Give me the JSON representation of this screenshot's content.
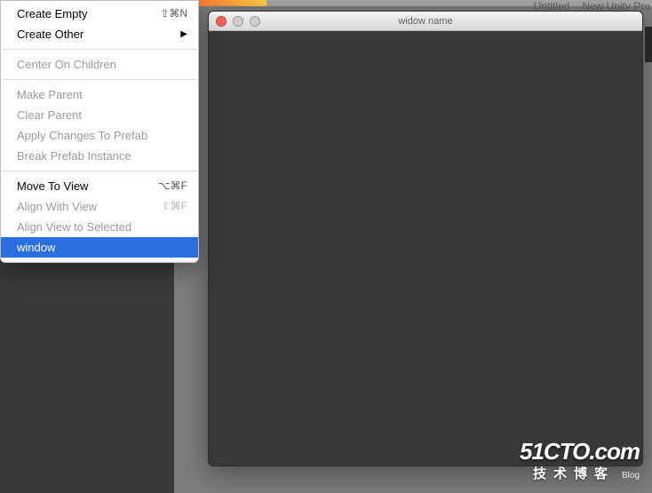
{
  "top_titles": {
    "a": "Untitled",
    "b": "New Unity Pro"
  },
  "menu": {
    "items": [
      {
        "label": "Create Empty",
        "shortcut": "⇧⌘N",
        "enabled": true,
        "submenu": false
      },
      {
        "label": "Create Other",
        "shortcut": "",
        "enabled": true,
        "submenu": true
      }
    ],
    "sep1": true,
    "group2": [
      {
        "label": "Center On Children",
        "shortcut": "",
        "enabled": false
      }
    ],
    "sep2": true,
    "group3": [
      {
        "label": "Make Parent",
        "shortcut": "",
        "enabled": false
      },
      {
        "label": "Clear Parent",
        "shortcut": "",
        "enabled": false
      },
      {
        "label": "Apply Changes To Prefab",
        "shortcut": "",
        "enabled": false
      },
      {
        "label": "Break Prefab Instance",
        "shortcut": "",
        "enabled": false
      }
    ],
    "sep3": true,
    "group4": [
      {
        "label": "Move To View",
        "shortcut": "⌥⌘F",
        "enabled": true
      },
      {
        "label": "Align With View",
        "shortcut": "⇧⌘F",
        "enabled": false
      },
      {
        "label": "Align View to Selected",
        "shortcut": "",
        "enabled": false
      },
      {
        "label": "window",
        "shortcut": "",
        "enabled": true,
        "selected": true
      }
    ]
  },
  "window": {
    "title": "widow name"
  },
  "watermark": {
    "main": "51CTO.com",
    "sub_cn": "技术博客",
    "sub_en": "Blog"
  }
}
